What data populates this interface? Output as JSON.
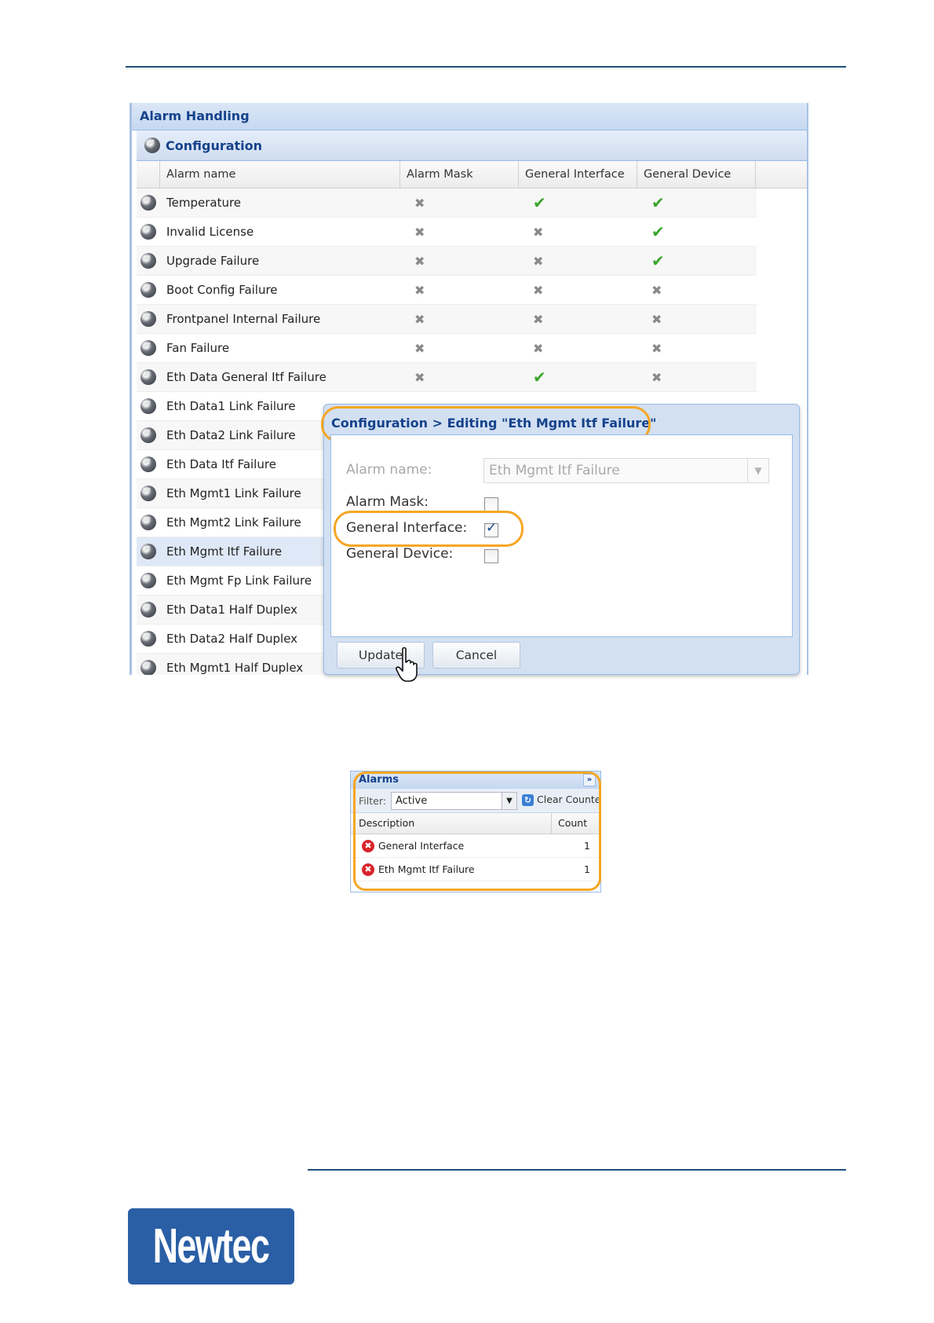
{
  "alarm_handling": {
    "title": "Alarm Handling",
    "section": "Configuration",
    "columns": [
      "Alarm name",
      "Alarm Mask",
      "General Interface",
      "General Device"
    ],
    "rows": [
      {
        "name": "Temperature",
        "mask": "x",
        "gi": "ok",
        "gd": "ok"
      },
      {
        "name": "Invalid License",
        "mask": "x",
        "gi": "x",
        "gd": "ok"
      },
      {
        "name": "Upgrade Failure",
        "mask": "x",
        "gi": "x",
        "gd": "ok"
      },
      {
        "name": "Boot Config Failure",
        "mask": "x",
        "gi": "x",
        "gd": "x"
      },
      {
        "name": "Frontpanel Internal Failure",
        "mask": "x",
        "gi": "x",
        "gd": "x"
      },
      {
        "name": "Fan Failure",
        "mask": "x",
        "gi": "x",
        "gd": "x"
      },
      {
        "name": "Eth Data General Itf Failure",
        "mask": "x",
        "gi": "ok",
        "gd": "x"
      },
      {
        "name": "Eth Data1 Link Failure",
        "mask": "",
        "gi": "",
        "gd": ""
      },
      {
        "name": "Eth Data2 Link Failure",
        "mask": "",
        "gi": "",
        "gd": ""
      },
      {
        "name": "Eth Data Itf Failure",
        "mask": "",
        "gi": "",
        "gd": ""
      },
      {
        "name": "Eth Mgmt1 Link Failure",
        "mask": "",
        "gi": "",
        "gd": ""
      },
      {
        "name": "Eth Mgmt2 Link Failure",
        "mask": "",
        "gi": "",
        "gd": ""
      },
      {
        "name": "Eth Mgmt Itf Failure",
        "mask": "",
        "gi": "",
        "gd": "",
        "selected": true
      },
      {
        "name": "Eth Mgmt Fp Link Failure",
        "mask": "",
        "gi": "",
        "gd": ""
      },
      {
        "name": "Eth Data1 Half Duplex",
        "mask": "",
        "gi": "",
        "gd": ""
      },
      {
        "name": "Eth Data2 Half Duplex",
        "mask": "",
        "gi": "",
        "gd": ""
      },
      {
        "name": "Eth Mgmt1 Half Duplex",
        "mask": "",
        "gi": "",
        "gd": ""
      }
    ]
  },
  "edit_dialog": {
    "title": "Configuration > Editing \"Eth Mgmt Itf Failure\"",
    "alarm_name_label": "Alarm name:",
    "alarm_name_value": "Eth Mgmt Itf Failure",
    "alarm_mask_label": "Alarm Mask:",
    "general_interface_label": "General Interface:",
    "general_device_label": "General Device:",
    "alarm_mask_checked": false,
    "general_interface_checked": true,
    "general_device_checked": false,
    "update_label": "Update",
    "cancel_label": "Cancel"
  },
  "alarms_panel": {
    "title": "Alarms",
    "filter_label": "Filter:",
    "filter_value": "Active",
    "clear_label": "Clear Counte",
    "columns": [
      "Description",
      "Count"
    ],
    "rows": [
      {
        "description": "General Interface",
        "count": "1"
      },
      {
        "description": "Eth Mgmt Itf Failure",
        "count": "1"
      }
    ]
  },
  "logo": {
    "text": "Newtec"
  },
  "colors": {
    "rule": "#1f4e79",
    "highlight": "#f5a623",
    "accent": "#15428b",
    "logo_bg": "#2a5fa5"
  }
}
